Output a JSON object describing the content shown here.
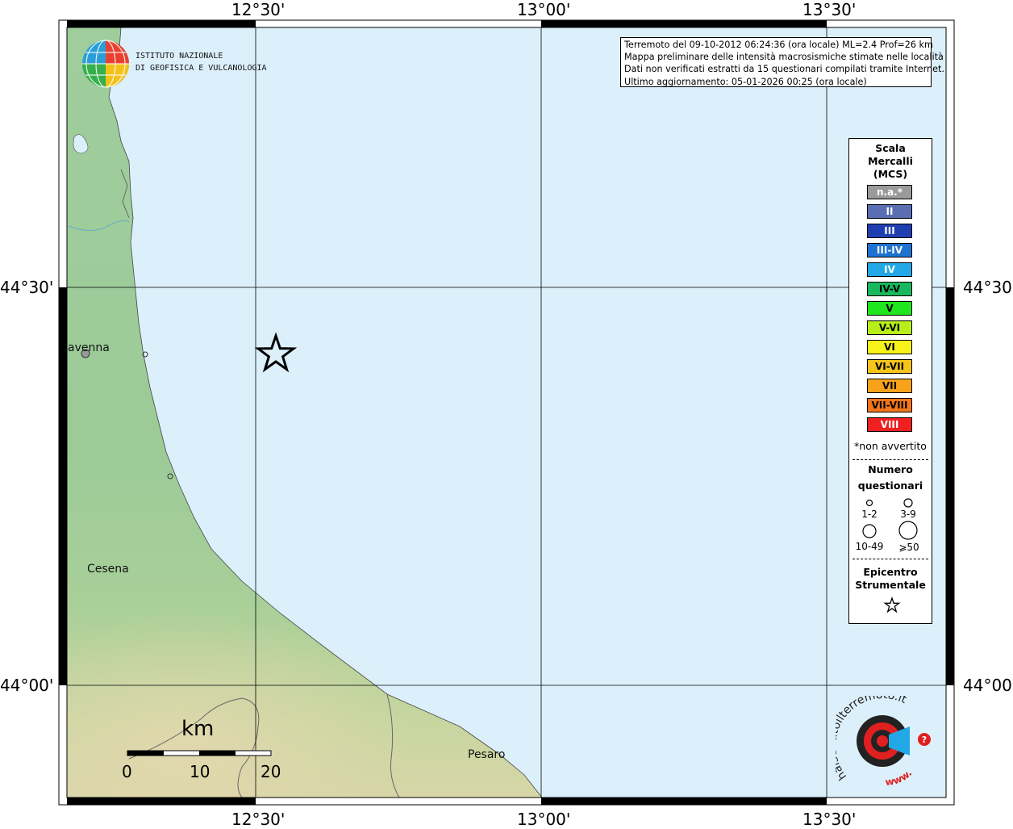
{
  "coordinates": {
    "top": [
      "12°30'",
      "13°00'",
      "13°30'"
    ],
    "bottom": [
      "12°30'",
      "13°00'",
      "13°30'"
    ],
    "left": [
      "44°30'",
      "44°00'"
    ],
    "right": [
      "44°30'",
      "44°00'"
    ]
  },
  "logo": {
    "line1": "ISTITUTO NAZIONALE",
    "line2": "DI GEOFISICA E VULCANOLOGIA"
  },
  "info": {
    "line1": "Terremoto del 09-10-2012 06:24:36 (ora locale) ML=2.4 Prof=26 km",
    "line2": "Mappa preliminare delle intensità macrosismiche stimate nelle località",
    "line3": "Dati non verificati estratti da 15 questionari compilati tramite Internet.",
    "line4": "Ultimo aggiornamento: 05-01-2026 00:25 (ora locale)"
  },
  "legend": {
    "title1": "Scala",
    "title2": "Mercalli",
    "title3": "(MCS)",
    "classes": [
      {
        "label": "n.a.*",
        "color": "#9a9a9a",
        "text_color": "#ffffff"
      },
      {
        "label": "II",
        "color": "#5a6fb3",
        "text_color": "#ffffff"
      },
      {
        "label": "III",
        "color": "#1f3fb0",
        "text_color": "#ffffff"
      },
      {
        "label": "III-IV",
        "color": "#1f73d0",
        "text_color": "#ffffff"
      },
      {
        "label": "IV",
        "color": "#22a8e6",
        "text_color": "#ffffff"
      },
      {
        "label": "IV-V",
        "color": "#17b85e",
        "text_color": "#000000"
      },
      {
        "label": "V",
        "color": "#1fe61f",
        "text_color": "#000000"
      },
      {
        "label": "V-VI",
        "color": "#b8ef1a",
        "text_color": "#000000"
      },
      {
        "label": "VI",
        "color": "#f7f21a",
        "text_color": "#000000"
      },
      {
        "label": "VI-VII",
        "color": "#f7c41a",
        "text_color": "#000000"
      },
      {
        "label": "VII",
        "color": "#f7a21a",
        "text_color": "#000000"
      },
      {
        "label": "VII-VIII",
        "color": "#f2761a",
        "text_color": "#000000"
      },
      {
        "label": "VIII",
        "color": "#ef2020",
        "text_color": "#ffffff"
      }
    ],
    "not_felt": "*non avvertito",
    "count_title1": "Numero",
    "count_title2": "questionari",
    "counts": [
      "1-2",
      "3-9",
      "10-49",
      "⩾50"
    ],
    "epicenter_title1": "Epicentro",
    "epicenter_title2": "Strumentale"
  },
  "places": {
    "ravenna": "avenna",
    "cesena": "Cesena",
    "pesaro": "Pesaro"
  },
  "scalebar": {
    "unit": "km",
    "ticks": [
      "0",
      "10",
      "20"
    ]
  },
  "hsit_logo": {
    "text": "haisentitoilterremoto.it",
    "www": "www."
  },
  "colors": {
    "sea": "#dcf0fb",
    "land": "#9ccc9a",
    "frame": "#000000",
    "grid": "#000000"
  }
}
